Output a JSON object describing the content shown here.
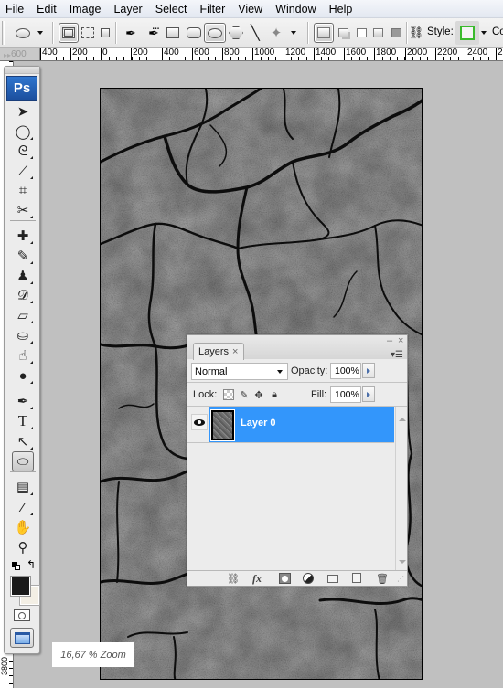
{
  "menubar": {
    "items": [
      "File",
      "Edit",
      "Image",
      "Layer",
      "Select",
      "Filter",
      "View",
      "Window",
      "Help"
    ]
  },
  "options_bar": {
    "tool_preset": "ellipse-icon",
    "modes": [
      "shape-layers-icon",
      "paths-icon",
      "fill-pixels-icon"
    ],
    "selected_mode": "shape-layers-icon",
    "shape_tools": [
      "pen-icon",
      "freeform-pen-icon",
      "rectangle-icon",
      "rounded-rectangle-icon",
      "ellipse-icon",
      "polygon-icon",
      "line-icon",
      "custom-shape-icon"
    ],
    "selected_shape": "ellipse-icon",
    "combine_modes": [
      "create-new-icon",
      "add-icon",
      "subtract-icon",
      "intersect-icon",
      "exclude-icon"
    ],
    "link_icon": "link-icon",
    "style_label": "Style:",
    "style_color": "#3aba2c",
    "color_label_partial": "Co"
  },
  "ruler": {
    "h_labels": [
      "600",
      "400",
      "200",
      "0",
      "200",
      "400",
      "600",
      "800",
      "1000",
      "1200",
      "1400",
      "1600",
      "1800",
      "2000",
      "2200",
      "2400",
      "2"
    ],
    "v_labels": [
      "3800"
    ]
  },
  "tools": {
    "logo": "Ps",
    "items": [
      {
        "name": "move-tool",
        "glyph": "➤"
      },
      {
        "name": "marquee-tool",
        "glyph": "◯"
      },
      {
        "name": "lasso-tool",
        "glyph": "ᘓ"
      },
      {
        "name": "quick-selection-tool",
        "glyph": "⟋"
      },
      {
        "name": "crop-tool",
        "glyph": "⌗"
      },
      {
        "name": "slice-tool",
        "glyph": "✂"
      },
      {
        "name": "healing-brush-tool",
        "glyph": "✚"
      },
      {
        "name": "brush-tool",
        "glyph": "✎"
      },
      {
        "name": "clone-stamp-tool",
        "glyph": "♟"
      },
      {
        "name": "history-brush-tool",
        "glyph": "𝒟"
      },
      {
        "name": "eraser-tool",
        "glyph": "▱"
      },
      {
        "name": "paint-bucket-tool",
        "glyph": "⛀"
      },
      {
        "name": "blur-tool",
        "glyph": "☝"
      },
      {
        "name": "dodge-tool",
        "glyph": "●"
      },
      {
        "name": "pen-tool",
        "glyph": "✒"
      },
      {
        "name": "type-tool",
        "glyph": "T"
      },
      {
        "name": "path-selection-tool",
        "glyph": "↖"
      },
      {
        "name": "shape-tool",
        "glyph": "⬭"
      },
      {
        "name": "notes-tool",
        "glyph": "▤"
      },
      {
        "name": "eyedropper-tool",
        "glyph": "⁄"
      },
      {
        "name": "hand-tool",
        "glyph": "✋"
      },
      {
        "name": "zoom-tool",
        "glyph": "⚲"
      }
    ],
    "active_tool": "shape-tool",
    "foreground_color": "#1a1a1a",
    "background_color": "#f3efe5"
  },
  "status": {
    "zoom_label": "16,67 % Zoom"
  },
  "layers_panel": {
    "tab_label": "Layers",
    "tab_close": "×",
    "minimize": "–",
    "close": "×",
    "menu_icon": "▾☰",
    "blend_mode": "Normal",
    "opacity_label": "Opacity:",
    "opacity_value": "100%",
    "lock_label": "Lock:",
    "lock_icons": [
      "lock-transparent-icon",
      "lock-image-icon",
      "lock-position-icon",
      "lock-all-icon"
    ],
    "fill_label": "Fill:",
    "fill_value": "100%",
    "layers": [
      {
        "name": "Layer 0",
        "visible": true,
        "selected": true
      }
    ],
    "selection_color": "#3396fb",
    "footer_icons": [
      "link-layers-icon",
      "fx-icon",
      "layer-mask-icon",
      "adjustment-layer-icon",
      "group-folder-icon",
      "new-layer-icon",
      "trash-icon"
    ],
    "fx_label": "fx"
  }
}
